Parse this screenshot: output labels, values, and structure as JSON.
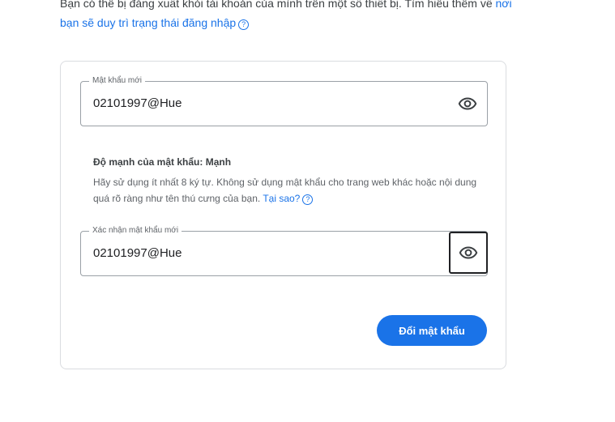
{
  "intro": {
    "text": "Bạn có thể bị đăng xuất khỏi tài khoản của mình trên một số thiết bị. Tìm hiểu thêm về ",
    "link": "nơi bạn sẽ duy trì trạng thái đăng nhập"
  },
  "new_password": {
    "label": "Mật khẩu mới",
    "value": "02101997@Hue"
  },
  "strength": {
    "title": "Độ mạnh của mật khẩu: Mạnh",
    "description": "Hãy sử dụng ít nhất 8 ký tự. Không sử dụng mật khẩu cho trang web khác hoặc nội dung quá rõ ràng như tên thú cưng của bạn. ",
    "link": "Tại sao?"
  },
  "confirm_password": {
    "label": "Xác nhận mật khẩu mới",
    "value": "02101997@Hue"
  },
  "submit_label": "Đổi mật khẩu",
  "icons": {
    "help": "help-circle-icon",
    "visibility": "eye-icon"
  },
  "colors": {
    "accent": "#1a73e8",
    "border": "#dadce0"
  }
}
